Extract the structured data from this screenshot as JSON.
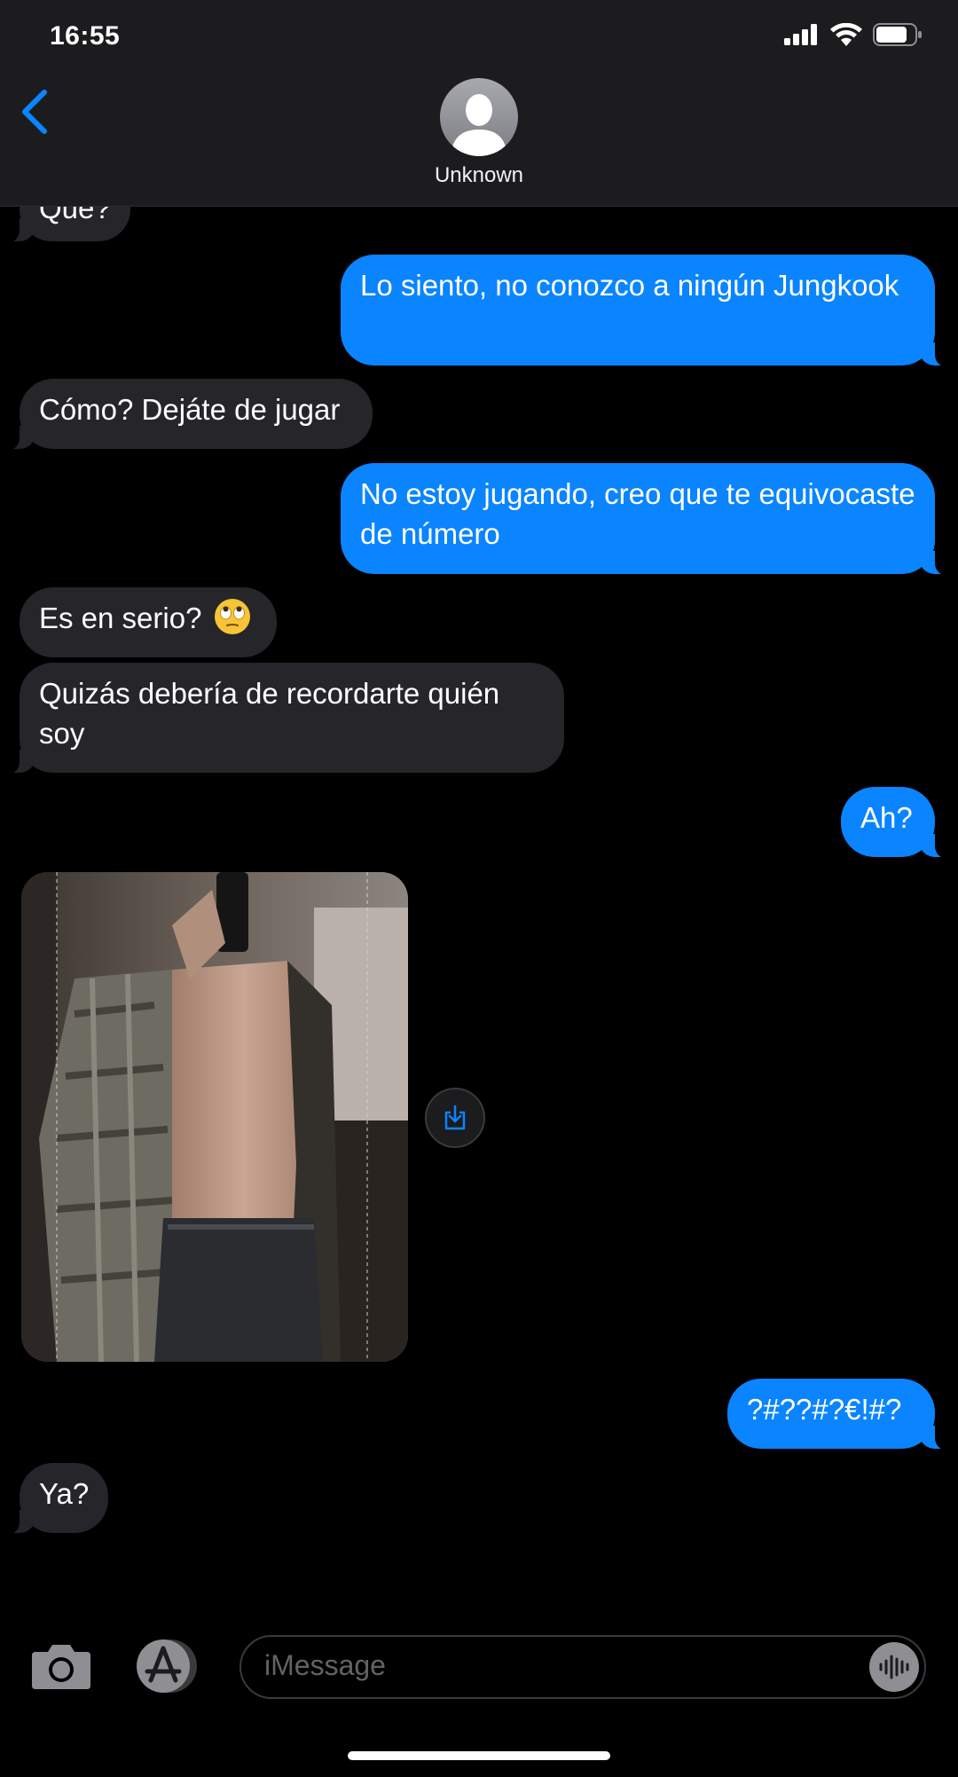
{
  "status_bar": {
    "time": "16:55"
  },
  "header": {
    "contact_name": "Unknown",
    "avatar_icon": "person-silhouette-icon",
    "back_icon": "chevron-left-icon"
  },
  "colors": {
    "outgoing": "#0a84ff",
    "incoming": "#26252a",
    "accent": "#0a84ff"
  },
  "messages": [
    {
      "direction": "in",
      "text": "Que?"
    },
    {
      "direction": "out",
      "text": "Lo siento, no conozco a ningún Jungkook"
    },
    {
      "direction": "in",
      "text": "Cómo? Dejáte de jugar"
    },
    {
      "direction": "out",
      "text": "No estoy jugando, creo que te equivocaste de número"
    },
    {
      "direction": "in",
      "text": "Es en serio?",
      "emoji": "face-with-rolling-eyes"
    },
    {
      "direction": "in",
      "text": "Quizás debería de recordarte quién soy"
    },
    {
      "direction": "out",
      "text": "Ah?"
    },
    {
      "direction": "in",
      "type": "photo"
    },
    {
      "direction": "out",
      "text": "?#??#?€!#?"
    },
    {
      "direction": "in",
      "text": "Ya?"
    }
  ],
  "input_bar": {
    "placeholder": "iMessage",
    "camera_icon": "camera-icon",
    "apps_icon": "app-store-icon",
    "audio_icon": "audio-waveform-icon"
  }
}
